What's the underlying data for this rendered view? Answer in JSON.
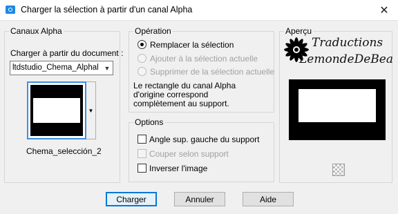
{
  "window": {
    "title": "Charger la sélection à partir d'un canal Alpha",
    "close_label": "✕",
    "accent_color": "#0078d7"
  },
  "alpha_group": {
    "legend": "Canaux Alpha",
    "load_from_label": "Charger à partir du document :",
    "document_select_value": "ltdstudio_Chema_Alphal",
    "channel_name": "Chema_selección_2"
  },
  "operation_group": {
    "legend": "Opération",
    "options": [
      {
        "label": "Remplacer la sélection",
        "checked": true,
        "enabled": true
      },
      {
        "label": "Ajouter à la sélection actuelle",
        "checked": false,
        "enabled": false
      },
      {
        "label": "Supprimer de la sélection actuelle",
        "checked": false,
        "enabled": false
      }
    ],
    "info_lines": [
      "Le rectangle du canal Alpha",
      "d'origine correspond",
      "complètement au support."
    ]
  },
  "options_group": {
    "legend": "Options",
    "items": [
      {
        "label": "Angle sup. gauche du support",
        "checked": false,
        "enabled": true
      },
      {
        "label": "Couper selon support",
        "checked": false,
        "enabled": false
      },
      {
        "label": "Inverser l'image",
        "checked": false,
        "enabled": true
      }
    ]
  },
  "preview_group": {
    "legend": "Aperçu",
    "watermark_line1": "Traductions",
    "watermark_line2": "LemondeDeBea"
  },
  "buttons": {
    "ok": "Charger",
    "cancel": "Annuler",
    "help": "Aide"
  }
}
